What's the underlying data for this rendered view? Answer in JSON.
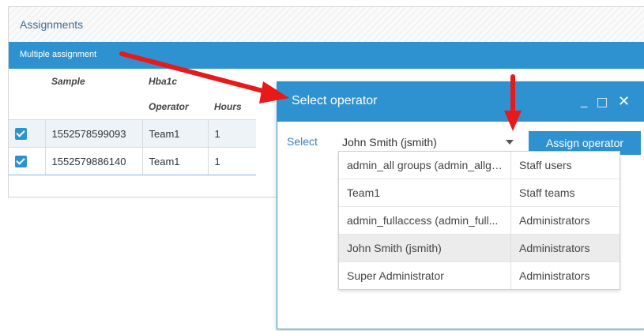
{
  "panel": {
    "title": "Assignments",
    "toolbar_button": "Multiple assignment",
    "columns": {
      "sample": "Sample",
      "analyte": "Hba1c",
      "operator": "Operator",
      "hours": "Hours"
    },
    "rows": [
      {
        "sample": "1552578599093",
        "operator": "Team1",
        "hours": "1",
        "checked": true
      },
      {
        "sample": "1552579886140",
        "operator": "Team1",
        "hours": "1",
        "checked": true
      }
    ]
  },
  "dialog": {
    "title": "Select operator",
    "select_label": "Select",
    "selected_value": "John Smith (jsmith)",
    "assign_button": "Assign operator",
    "options": [
      {
        "name": "admin_all groups  (admin_allgr...",
        "group": "Staff users"
      },
      {
        "name": "Team1",
        "group": "Staff teams"
      },
      {
        "name": "admin_fullaccess  (admin_full...",
        "group": "Administrators"
      },
      {
        "name": "John Smith (jsmith)",
        "group": "Administrators",
        "highlighted": true
      },
      {
        "name": "Super Administrator",
        "group": "Administrators"
      }
    ]
  },
  "colors": {
    "accent": "#2f92d0",
    "annotation_arrow": "#e8191b"
  }
}
